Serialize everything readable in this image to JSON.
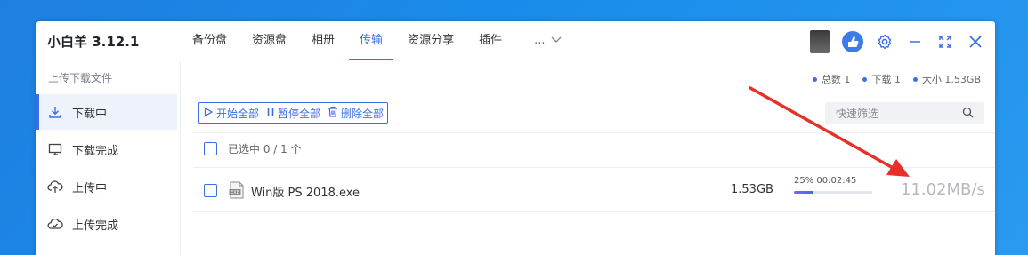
{
  "app": {
    "title": "小白羊 3.12.1"
  },
  "nav": {
    "tabs": [
      {
        "label": "备份盘"
      },
      {
        "label": "资源盘"
      },
      {
        "label": "相册"
      },
      {
        "label": "传输",
        "active": true
      },
      {
        "label": "资源分享"
      },
      {
        "label": "插件"
      }
    ],
    "more_label": "..."
  },
  "window_controls": {
    "icons": [
      "avatar-thumbnail",
      "user-avatar-icon",
      "gear-icon",
      "minimize-icon",
      "fullscreen-icon",
      "close-icon"
    ],
    "accent": "#3b6ee6"
  },
  "sidebar": {
    "title": "上传下载文件",
    "items": [
      {
        "label": "下载中",
        "icon": "download-icon",
        "active": true
      },
      {
        "label": "下载完成",
        "icon": "monitor-icon"
      },
      {
        "label": "上传中",
        "icon": "cloud-upload-icon"
      },
      {
        "label": "上传完成",
        "icon": "cloud-check-icon"
      }
    ]
  },
  "stats": {
    "total": "总数 1",
    "downloading": "下载 1",
    "size": "大小 1.53GB"
  },
  "toolbar": {
    "start_all": "开始全部",
    "pause_all": "暂停全部",
    "delete_all": "删除全部"
  },
  "search": {
    "placeholder": "快速筛选"
  },
  "selection": {
    "label": "已选中 0 / 1 个"
  },
  "tasks": [
    {
      "name": "Win版 PS 2018.exe",
      "size": "1.53GB",
      "progress_text": "25% 00:02:45",
      "progress_fraction": 0.25,
      "speed": "11.02MB/s"
    }
  ],
  "colors": {
    "accent": "#3b6ee6",
    "annotation_arrow": "#e8302a"
  }
}
